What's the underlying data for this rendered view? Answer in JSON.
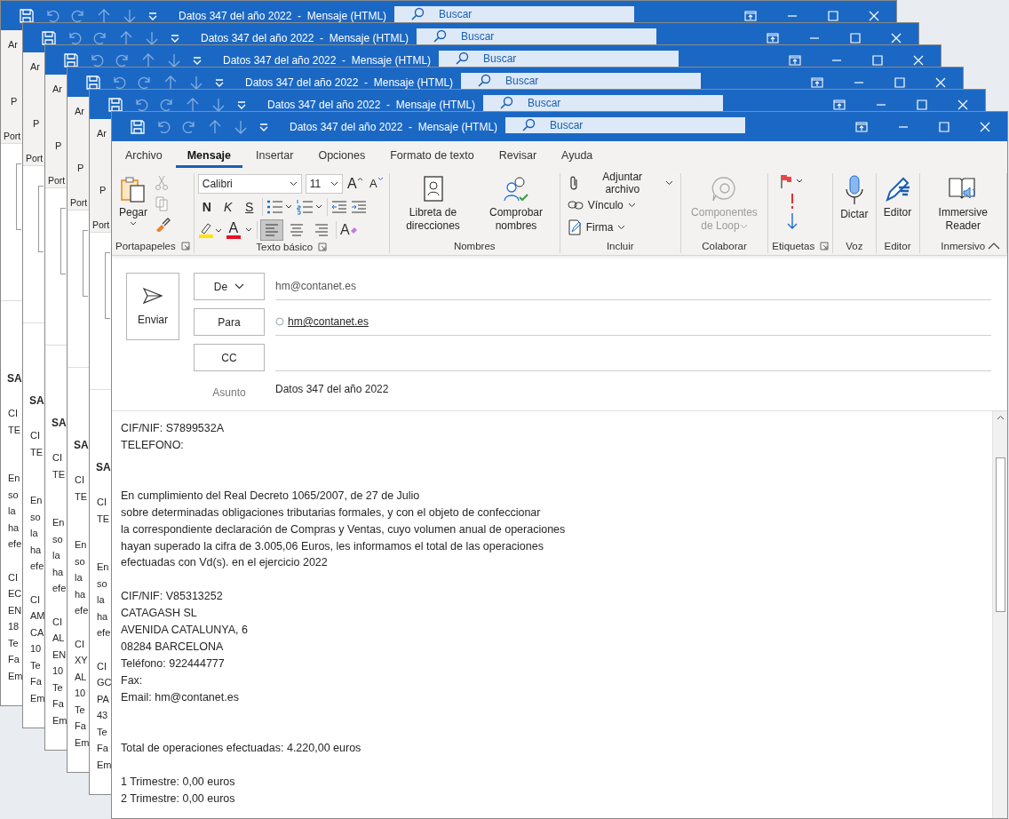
{
  "background_windows": [
    {
      "title": "Datos 347 del año 2022  -  Mensaje (HTML)",
      "search": {
        "placeholder": "Buscar"
      },
      "ribbon_fragments": [
        "Ar",
        "P",
        "Port"
      ],
      "heading": "SA",
      "lines_1": [
        "CI",
        "TE"
      ],
      "lines_2": [
        "En",
        "so",
        "la",
        "ha",
        "efe"
      ],
      "lines_3": [
        "CI",
        "EC",
        "EN",
        "18",
        "Te",
        "Fa",
        "Em"
      ]
    },
    {
      "title": "Datos 347 del año 2022  -  Mensaje (HTML)",
      "search": {
        "placeholder": "Buscar"
      },
      "ribbon_fragments": [
        "Ar",
        "P",
        "Port"
      ],
      "heading": "SA",
      "lines_1": [
        "CI",
        "TE"
      ],
      "lines_2": [
        "En",
        "so",
        "la",
        "ha",
        "efe"
      ],
      "lines_3": [
        "CI",
        "AM",
        "CA",
        "10",
        "Te",
        "Fa",
        "Em"
      ]
    },
    {
      "title": "Datos 347 del año 2022  -  Mensaje (HTML)",
      "search": {
        "placeholder": "Buscar"
      },
      "ribbon_fragments": [
        "Ar",
        "P",
        "Port"
      ],
      "heading": "SA",
      "lines_1": [
        "CI",
        "TE"
      ],
      "lines_2": [
        "En",
        "so",
        "la",
        "ha",
        "efe"
      ],
      "lines_3": [
        "CI",
        "AL",
        "EN",
        "10",
        "Te",
        "Fa",
        "Em"
      ]
    },
    {
      "title": "Datos 347 del año 2022  -  Mensaje (HTML)",
      "search": {
        "placeholder": "Buscar"
      },
      "ribbon_fragments": [
        "Ar",
        "P",
        "Port"
      ],
      "heading": "SA",
      "lines_1": [
        "CI",
        "TE"
      ],
      "lines_2": [
        "En",
        "so",
        "la",
        "ha",
        "efe"
      ],
      "lines_3": [
        "CI",
        "XY",
        "AL",
        "10",
        "Te",
        "Fa",
        "Em"
      ]
    },
    {
      "title": "Datos 347 del año 2022  -  Mensaje (HTML)",
      "search": {
        "placeholder": "Buscar"
      },
      "ribbon_fragments": [
        "Ar",
        "P",
        "Port"
      ],
      "heading": "SA",
      "lines_1": [
        "CI",
        "TE"
      ],
      "lines_2": [
        "En",
        "so",
        "la",
        "ha",
        "efe"
      ],
      "lines_3": [
        "CI",
        "GC",
        "PA",
        "43",
        "Te",
        "Fa",
        "Em"
      ]
    }
  ],
  "window": {
    "title": "Datos 347 del año 2022  -  Mensaje (HTML)",
    "search": {
      "placeholder": "Buscar"
    }
  },
  "tabs": [
    {
      "label": "Archivo",
      "selected": false
    },
    {
      "label": "Mensaje",
      "selected": true
    },
    {
      "label": "Insertar",
      "selected": false
    },
    {
      "label": "Opciones",
      "selected": false
    },
    {
      "label": "Formato de texto",
      "selected": false
    },
    {
      "label": "Revisar",
      "selected": false
    },
    {
      "label": "Ayuda",
      "selected": false
    }
  ],
  "ribbon": {
    "groups": [
      {
        "kind": "clipboard",
        "label": "Portapapeles",
        "launcher": true,
        "paste": "Pegar"
      },
      {
        "kind": "font",
        "label": "Texto básico",
        "launcher": true,
        "font": "Calibri",
        "size": "11",
        "grow": "A",
        "shrink": "A",
        "bold": "N",
        "italic": "K",
        "underline": "S",
        "font_color": "A",
        "clear_format": "A",
        "align": [
          {
            "selected": true
          },
          {
            "selected": false
          },
          {
            "selected": false
          }
        ]
      },
      {
        "kind": "large",
        "label": "Nombres",
        "launcher": false,
        "buttons": [
          {
            "kind": "address_book",
            "label": "Libreta de direcciones",
            "disabled": false,
            "dropdown": false
          },
          {
            "kind": "check_names",
            "label": "Comprobar nombres",
            "disabled": false,
            "dropdown": false
          }
        ]
      },
      {
        "kind": "include",
        "label": "Incluir",
        "launcher": false,
        "items": [
          {
            "kind": "attach",
            "label": "Adjuntar archivo"
          },
          {
            "kind": "link",
            "label": "Vínculo"
          },
          {
            "kind": "signature",
            "label": "Firma"
          }
        ]
      },
      {
        "kind": "large",
        "label": "Colaborar",
        "launcher": false,
        "buttons": [
          {
            "kind": "loop",
            "label": "Componentes de Loop",
            "disabled": true,
            "dropdown": true
          }
        ]
      },
      {
        "kind": "tags",
        "label": "Etiquetas",
        "launcher": true
      },
      {
        "kind": "large",
        "label": "Voz",
        "launcher": false,
        "buttons": [
          {
            "kind": "mic",
            "label": "Dictar",
            "disabled": false,
            "dropdown": false
          }
        ]
      },
      {
        "kind": "large",
        "label": "Editor",
        "launcher": false,
        "buttons": [
          {
            "kind": "editor",
            "label": "Editor",
            "disabled": false,
            "dropdown": false
          }
        ]
      },
      {
        "kind": "large",
        "label": "Inmersivo",
        "launcher": false,
        "buttons": [
          {
            "kind": "reader",
            "label": "Immersive Reader",
            "disabled": false,
            "dropdown": false
          }
        ]
      }
    ]
  },
  "header": {
    "send": "Enviar",
    "from": {
      "button": "De",
      "value": "hm@contanet.es"
    },
    "to": {
      "button": "Para",
      "recipients": [
        "hm@contanet.es"
      ]
    },
    "cc": {
      "button": "CC"
    },
    "subject": {
      "label": "Asunto",
      "value": "Datos 347 del año 2022"
    }
  },
  "body": {
    "paragraphs": [
      [
        "CIF/NIF: S7899532A",
        "TELEFONO:"
      ],
      [
        "En cumplimiento del Real Decreto 1065/2007, de 27 de Julio",
        "sobre determinadas obligaciones tributarias formales, y con el objeto de confeccionar",
        "la correspondiente declaración de Compras y Ventas, cuyo volumen anual de operaciones",
        "hayan superado la cifra de 3.005,06 Euros, les informamos el total de las operaciones",
        "efectuadas con Vd(s). en el ejercicio 2022"
      ],
      [
        "CIF/NIF: V85313252",
        "CATAGASH SL",
        "AVENIDA CATALUNYA, 6",
        "08284 BARCELONA",
        "Teléfono: 922444777",
        "Fax:",
        "Email: hm@contanet.es"
      ],
      [
        "Total de operaciones efectuadas: 4.220,00 euros"
      ],
      [
        "1 Trimestre: 0,00 euros",
        "2 Trimestre: 0,00 euros"
      ]
    ]
  }
}
